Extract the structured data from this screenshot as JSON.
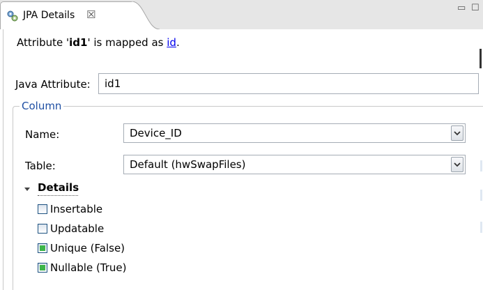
{
  "tab": {
    "title": "JPA Details",
    "icon": "jpa-details-icon",
    "close_glyph": "☒"
  },
  "window_controls": {
    "minimize": "▭",
    "maximize": "☐"
  },
  "header": {
    "prefix": "Attribute '",
    "attribute_name": "id1",
    "middle": "' is mapped as ",
    "mapping_link": "id",
    "suffix": "."
  },
  "java_attribute": {
    "label": "Java Attribute:",
    "value": "id1"
  },
  "column_group": {
    "title": "Column",
    "name": {
      "label": "Name:",
      "value": "Device_ID"
    },
    "table": {
      "label": "Table:",
      "value": "Default (hwSwapFiles)"
    }
  },
  "details": {
    "title": "Details",
    "expanded": true,
    "options": [
      {
        "label": "Insertable",
        "state": "unchecked"
      },
      {
        "label": "Updatable",
        "state": "unchecked"
      },
      {
        "label": "Unique (False)",
        "state": "default"
      },
      {
        "label": "Nullable (True)",
        "state": "default"
      }
    ]
  },
  "colors": {
    "group_title": "#1f4fa3",
    "link": "#0000ee",
    "checkbox_default_fill": "#3db549"
  }
}
